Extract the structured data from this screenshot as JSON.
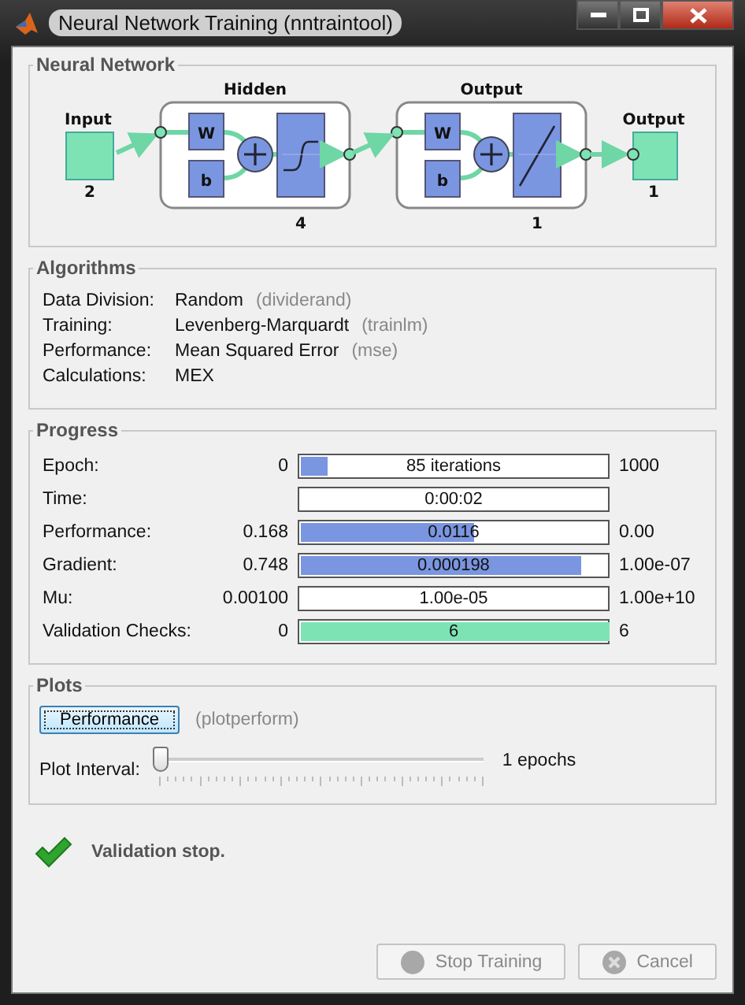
{
  "window": {
    "title": "Neural Network Training (nntraintool)"
  },
  "network": {
    "title": "Neural Network",
    "input": {
      "label": "Input",
      "size": "2"
    },
    "layers": [
      {
        "title": "Hidden",
        "size": "4",
        "weight": "W",
        "bias": "b",
        "kind": "sigmoid"
      },
      {
        "title": "Output",
        "size": "1",
        "weight": "W",
        "bias": "b",
        "kind": "linear"
      }
    ],
    "output": {
      "label": "Output",
      "size": "1"
    }
  },
  "algorithms": {
    "title": "Algorithms",
    "rows": [
      {
        "label": "Data Division:",
        "value": "Random",
        "function": "(dividerand)"
      },
      {
        "label": "Training:",
        "value": "Levenberg-Marquardt",
        "function": "(trainlm)"
      },
      {
        "label": "Performance:",
        "value": "Mean Squared Error",
        "function": "(mse)"
      },
      {
        "label": "Calculations:",
        "value": "MEX"
      }
    ]
  },
  "progress": {
    "title": "Progress",
    "rows": [
      {
        "label": "Epoch:",
        "start": "0",
        "text": "85 iterations",
        "end": "1000",
        "level": 0.085,
        "color": "#7b96e0"
      },
      {
        "label": "Time:",
        "text": "0:00:02"
      },
      {
        "label": "Performance:",
        "start": "0.168",
        "text": "0.0116",
        "end": "0.00",
        "level": 0.56,
        "color": "#7b96e0"
      },
      {
        "label": "Gradient:",
        "start": "0.748",
        "text": "0.000198",
        "end": "1.00e-07",
        "level": 0.91,
        "color": "#7b96e0"
      },
      {
        "label": "Mu:",
        "start": "0.00100",
        "text": "1.00e-05",
        "end": "1.00e+10"
      },
      {
        "label": "Validation Checks:",
        "start": "0",
        "text": "6",
        "end": "6",
        "level": 1,
        "color": "#7de3b5"
      }
    ]
  },
  "plots": {
    "title": "Plots",
    "items": [
      {
        "label": "Performance",
        "function": "(plotperform)",
        "focused": true
      }
    ],
    "interval": {
      "label": "Plot Interval:",
      "level": 0,
      "reading": "1 epochs"
    }
  },
  "status": {
    "text": "Validation stop.",
    "kind": "success"
  },
  "buttons": [
    {
      "label": "Stop Training",
      "kind": "stop",
      "disabled": true
    },
    {
      "label": "Cancel",
      "kind": "cancel",
      "disabled": true
    }
  ]
}
